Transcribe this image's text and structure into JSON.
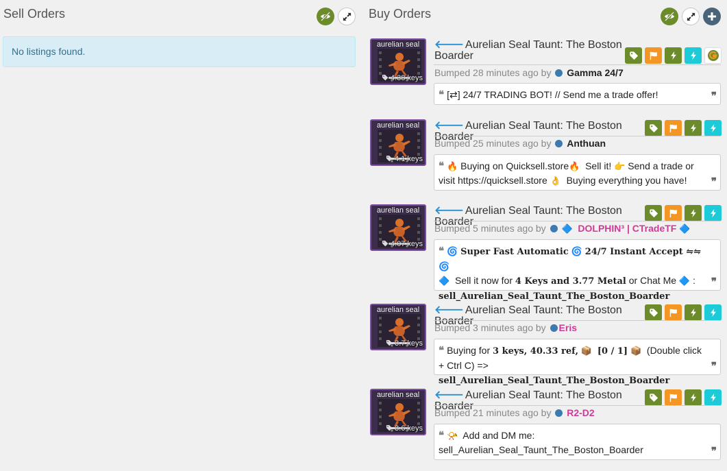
{
  "sell": {
    "title": "Sell Orders",
    "empty_text": "No listings found."
  },
  "buy": {
    "title": "Buy Orders"
  },
  "colors": {
    "green": "#6c8b2b",
    "orange": "#f39623",
    "cyan": "#1ccad8",
    "link_blue": "#2b8fd0",
    "pink": "#cf3a98"
  },
  "icons": {
    "visibility": "eye-icon",
    "expand": "expand-icon",
    "add": "plus-icon",
    "tag": "tag-icon",
    "flag": "flag-icon",
    "bolt": "bolt-icon",
    "quote_open": "quote-open-icon",
    "quote_close": "quote-close-icon"
  },
  "listings": [
    {
      "img_name": "aurelian seal",
      "price": "4.38 keys",
      "title": "Aurelian Seal Taunt: The Boston Boarder",
      "bumped": "Bumped 28 minutes ago by",
      "user": "Gamma 24/7",
      "msg": {
        "quote": "❝",
        "icon": "[⇄]",
        "text": "24/7 TRADING BOT! // Send me a trade offer!",
        "end": "❞"
      }
    },
    {
      "img_name": "aurelian seal",
      "price": "4.1 keys",
      "title": "Aurelian Seal Taunt: The Boston Boarder",
      "bumped": "Bumped 25 minutes ago by",
      "user": "Anthuan",
      "msg": {
        "quote": "❝",
        "e1": "🔥",
        "t1": "Buying on Quicksell.store",
        "e2": "🔥",
        "t2": "Sell it!",
        "e3": "👉",
        "t3": "Send a trade or visit https://quicksell.store",
        "e4": "👌",
        "t4": "Buying everything you have!",
        "end": "❞"
      }
    },
    {
      "img_name": "aurelian seal",
      "price": "4.07 keys",
      "title": "Aurelian Seal Taunt: The Boston Boarder",
      "bumped": "Bumped 5 minutes ago by",
      "user_prefix": "🔷",
      "user": "DOLPHIN³ | CTradeTF",
      "user_suffix": "🔷",
      "msg": {
        "quote": "❝",
        "e1": "🌀",
        "b1": "Super Fast Automatic",
        "e2": "🌀",
        "b2": "24/7 Instant Accept ⇋⇋",
        "e3": "🌀",
        "e4": "🔷",
        "t1": "Sell it now for",
        "b3": "4 Keys and 3.77 Metal",
        "t2": "or Chat Me",
        "e5": "🔷",
        "t3": ":",
        "b4": "sell_Aurelian_Seal_Taunt_The_Boston_Boarder",
        "end": "❞"
      }
    },
    {
      "img_name": "aurelian seal",
      "price": "3.7 keys",
      "title": "Aurelian Seal Taunt: The Boston Boarder",
      "bumped": "Bumped 3 minutes ago by",
      "user": "Eris",
      "msg": {
        "quote": "❝",
        "t1": "Buying for",
        "b1": "3 keys, 40.33 ref,",
        "e1": "📦",
        "b2": "[0 / 1]",
        "e2": "📦",
        "t2": "(Double click + Ctrl C) =>",
        "b3": "sell_Aurelian_Seal_Taunt_The_Boston_Boarder",
        "end": "❞"
      }
    },
    {
      "img_name": "aurelian seal",
      "price": "3.6 keys",
      "title": "Aurelian Seal Taunt: The Boston Boarder",
      "bumped": "Bumped 21 minutes ago by",
      "user": "R2-D2",
      "msg": {
        "quote": "❝",
        "e1": "📯",
        "t1": "Add and DM me:",
        "t2": "sell_Aurelian_Seal_Taunt_The_Boston_Boarder",
        "end": "❞"
      }
    }
  ]
}
